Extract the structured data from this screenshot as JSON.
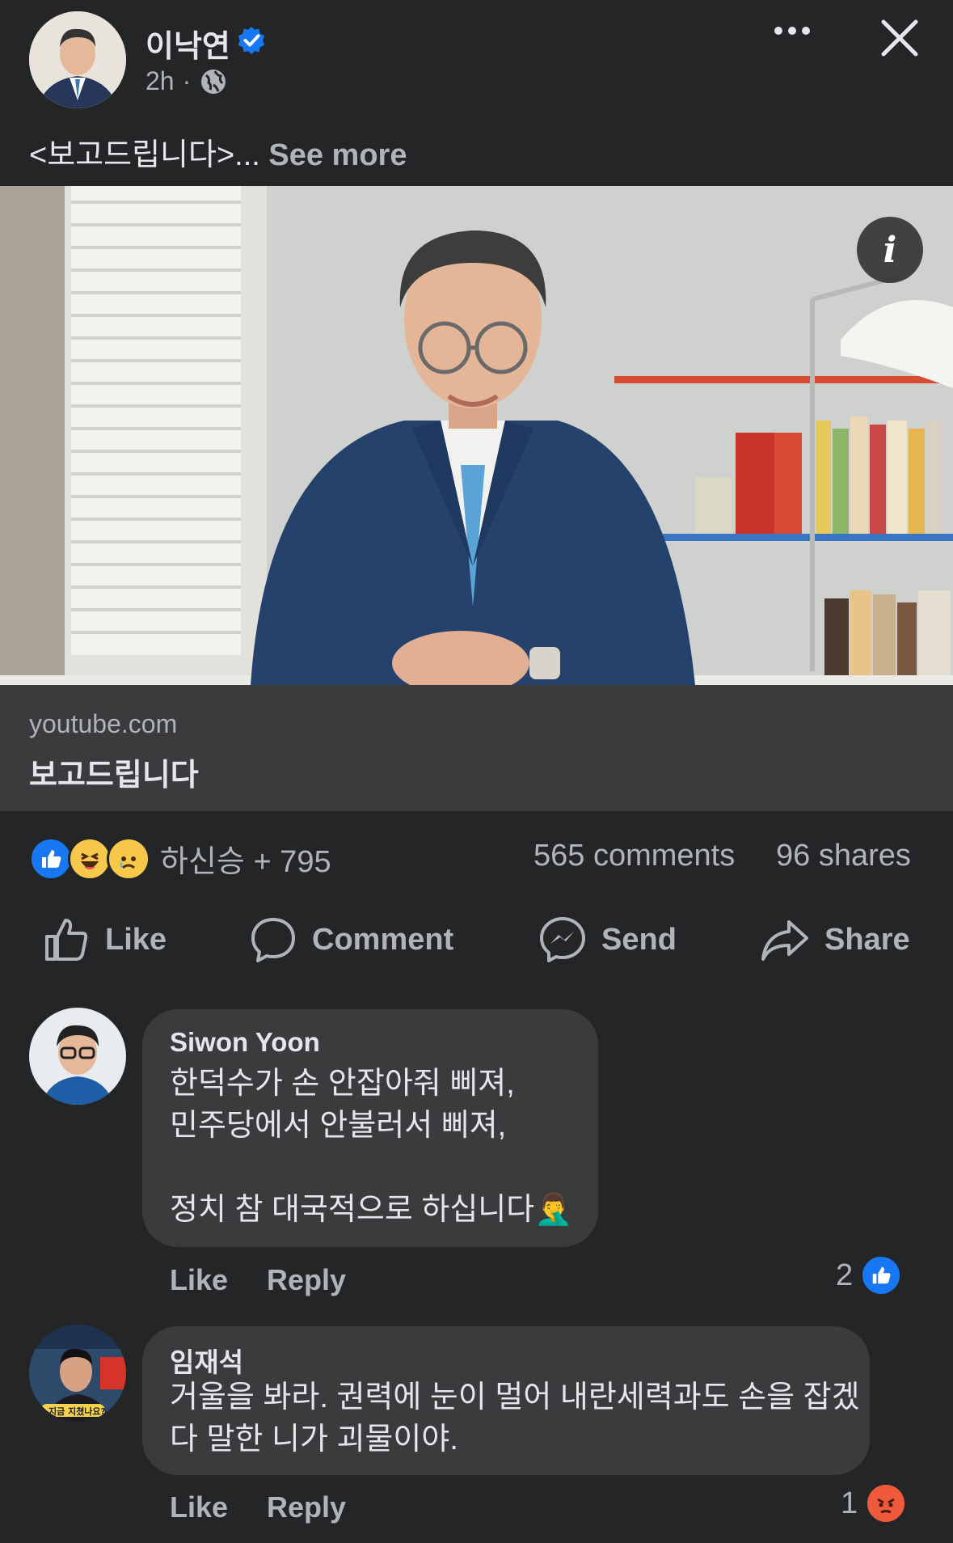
{
  "post": {
    "author": "이낙연",
    "time": "2h",
    "time_separator": "·",
    "text": "<보고드립니다>...",
    "see_more": "See more"
  },
  "link": {
    "domain": "youtube.com",
    "title": "보고드립니다",
    "info_glyph": "i"
  },
  "reactions": {
    "summary": "하신승 + 795",
    "comments": "565 comments",
    "shares": "96 shares"
  },
  "actions": {
    "like": "Like",
    "comment": "Comment",
    "send": "Send",
    "share": "Share"
  },
  "comments": [
    {
      "author": "Siwon Yoon",
      "text": "한덕수가 손 안잡아줘 삐져,\n민주당에서 안불러서 삐져,\n\n정치 참 대국적으로 하십니다🤦‍♂️",
      "like": "Like",
      "reply": "Reply",
      "reaction_count": "2"
    },
    {
      "author": "임재석",
      "text": "거울을 봐라. 권력에 눈이 멀어 내란세력과도 손을 잡겠\n다 말한 니가 괴물이야.",
      "like": "Like",
      "reply": "Reply",
      "reaction_count": "1",
      "avatar_caption": "지금 지쳤나요?"
    }
  ],
  "colors": {
    "background": "#242526",
    "card": "#3a3b3c",
    "text_primary": "#e4e6eb",
    "text_secondary": "#b0b3b8",
    "facebook_blue": "#1877f2",
    "angry": "#f05a3c"
  },
  "icons": {
    "verified": "verified-badge-icon",
    "globe": "globe-icon",
    "more": "more-horizontal-icon",
    "close": "close-icon",
    "like": "thumbs-up-icon",
    "comment": "speech-bubble-icon",
    "send": "messenger-icon",
    "share": "share-arrow-icon"
  }
}
